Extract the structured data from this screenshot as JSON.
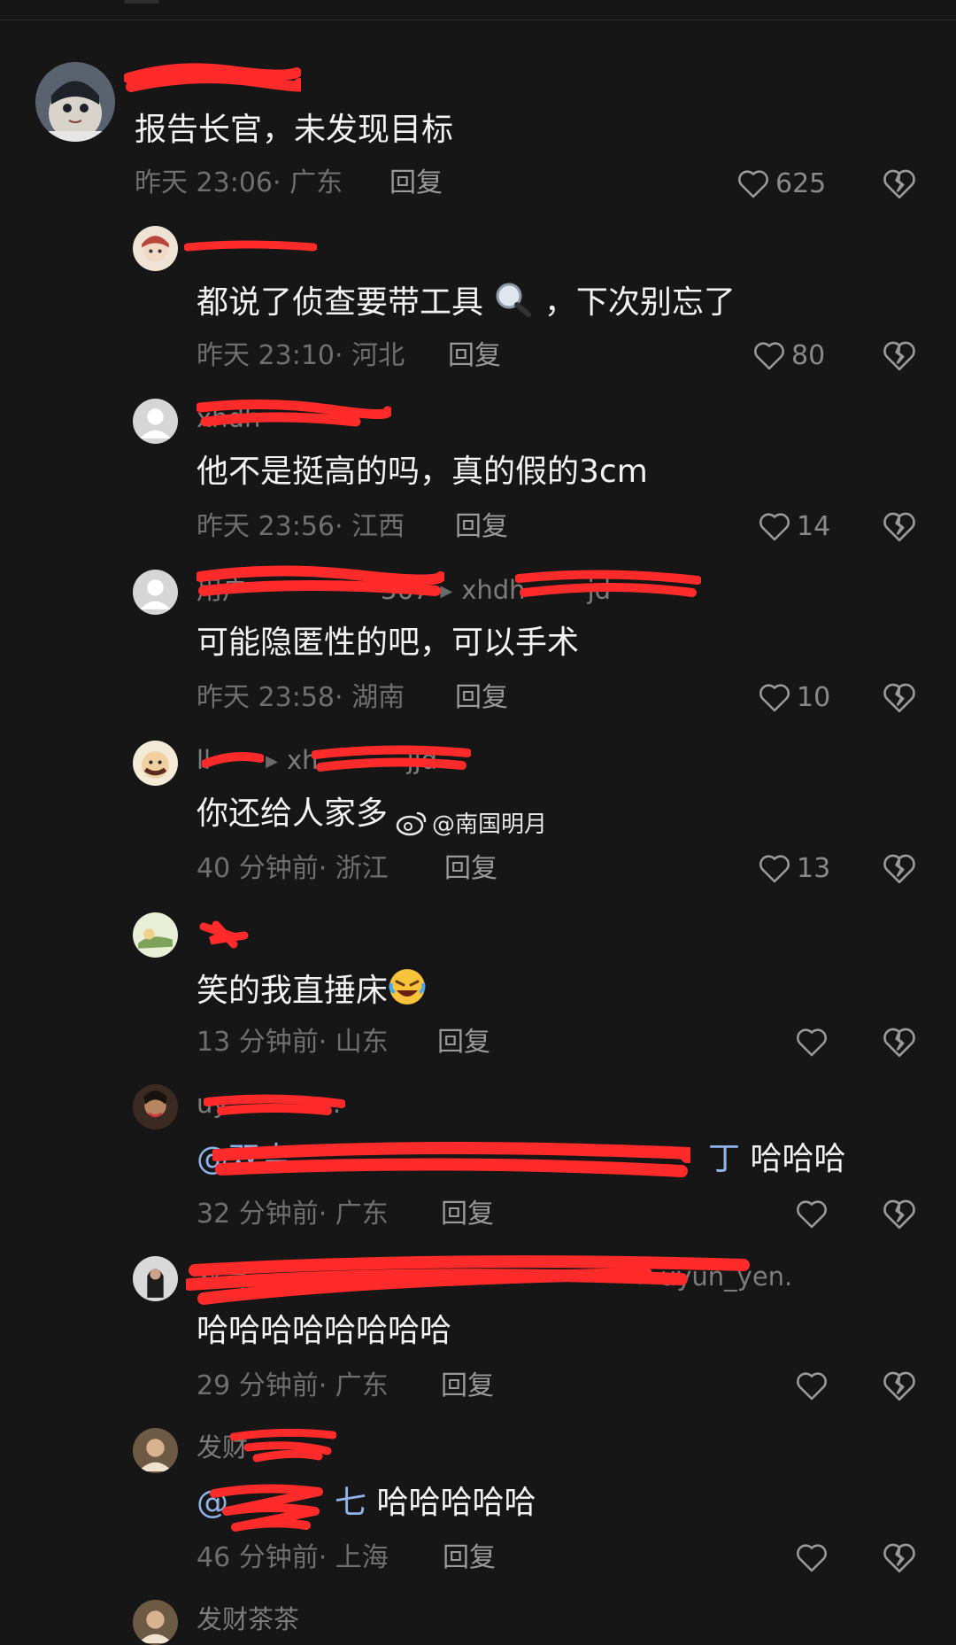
{
  "watermark": "@南国明月",
  "comments": [
    {
      "username": "",
      "text": "报告长官，未发现目标",
      "time": "昨天 23:06",
      "location": "广东",
      "reply_label": "回复",
      "likes": "625",
      "like_icon": "heart-icon",
      "dislike_icon": "broken-heart-icon"
    },
    {
      "username": "",
      "text_before": "都说了侦查要带工具",
      "text_after": "，下次别忘了",
      "emoji": "magnifier-emoji",
      "time": "昨天 23:10",
      "location": "河北",
      "reply_label": "回复",
      "likes": "80"
    },
    {
      "username": "xhdh",
      "text": "他不是挺高的吗，真的假的3cm",
      "time": "昨天 23:56",
      "location": "江西",
      "reply_label": "回复",
      "likes": "14"
    },
    {
      "username": "用户",
      "username_mid": "367",
      "reply_to": "xhdh",
      "reply_to_tail": "jd",
      "text": "可能隐匿性的吧，可以手术",
      "time": "昨天 23:58",
      "location": "湖南",
      "reply_label": "回复",
      "likes": "10"
    },
    {
      "username": "ll",
      "reply_to": "xh",
      "reply_to_tail": "jjd",
      "text": "你还给人家多",
      "time": "40 分钟前",
      "location": "浙江",
      "reply_label": "回复",
      "likes": "13"
    },
    {
      "username": "",
      "text": "笑的我直捶床",
      "emoji": "rolling-laugh-emoji",
      "time": "13 分钟前",
      "location": "山东",
      "reply_label": "回复",
      "likes": ""
    },
    {
      "username": "uy",
      "username_tail": "n.",
      "mention": "@双吉",
      "mention_tail": "丁",
      "text": "哈哈哈",
      "time": "32 分钟前",
      "location": "广东",
      "reply_label": "回复",
      "likes": ""
    },
    {
      "username": "双吉",
      "reply_to": "uyun_yen.",
      "text": "哈哈哈哈哈哈哈哈",
      "time": "29 分钟前",
      "location": "广东",
      "reply_label": "回复",
      "likes": ""
    },
    {
      "username": "发财",
      "mention": "@",
      "mention_tail": "七",
      "text": "哈哈哈哈哈",
      "time": "46 分钟前",
      "location": "上海",
      "reply_label": "回复",
      "likes": ""
    },
    {
      "username": "发财茶茶"
    }
  ],
  "colors": {
    "background": "#161616",
    "scribble": "#ff2a2a",
    "mention": "#8fb3e8"
  }
}
